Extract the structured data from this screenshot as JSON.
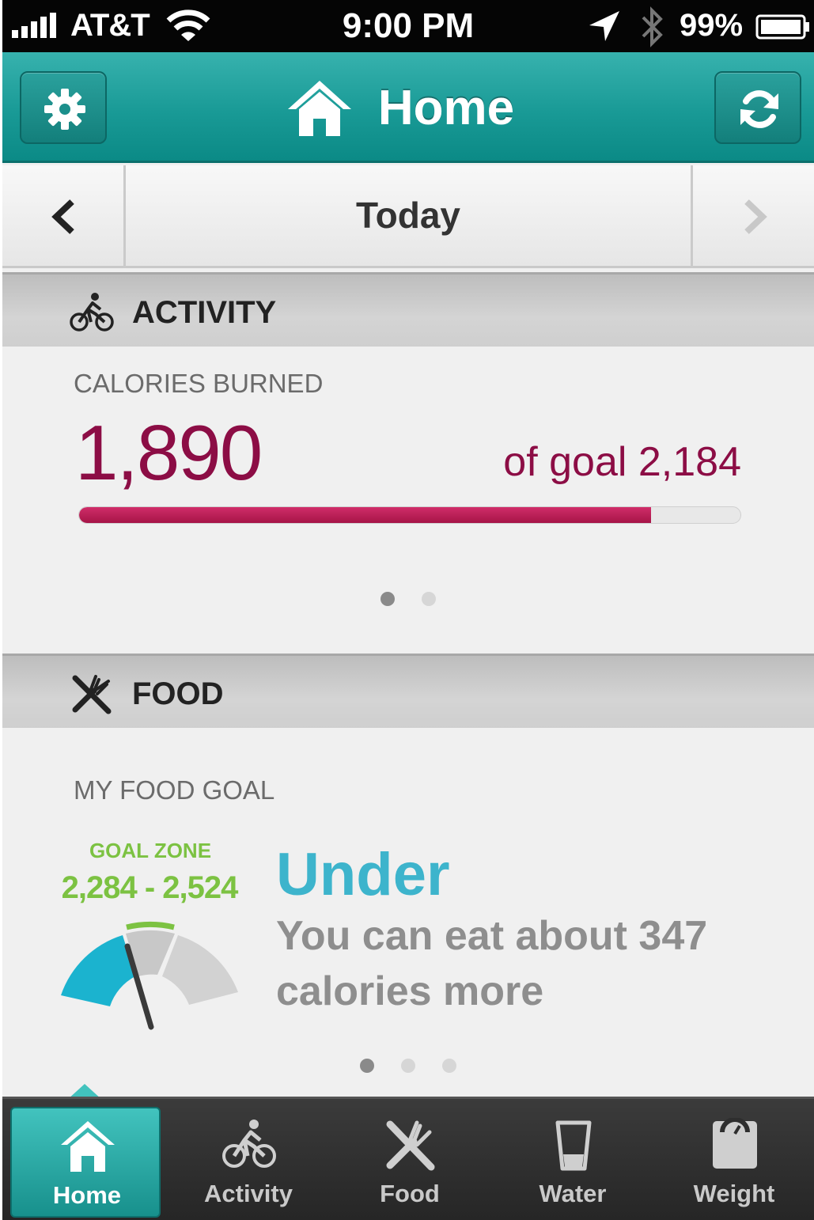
{
  "status_bar": {
    "carrier": "AT&T",
    "time": "9:00 PM",
    "battery_percent": "99%",
    "icons": [
      "signal-icon",
      "wifi-icon",
      "location-arrow-icon",
      "bluetooth-icon",
      "battery-icon"
    ]
  },
  "nav": {
    "title": "Home",
    "icons": {
      "left": "gear-icon",
      "center": "home-icon",
      "right": "sync-icon"
    }
  },
  "date_bar": {
    "label": "Today",
    "icons": {
      "prev": "chevron-left-icon",
      "next": "chevron-right-icon"
    }
  },
  "activity": {
    "section_title": "ACTIVITY",
    "icon": "bicycle-icon",
    "metric_label": "CALORIES BURNED",
    "value": "1,890",
    "goal_text": "of goal 2,184",
    "progress": 0.865,
    "colors": {
      "value": "#8c0d45",
      "bar": "#c2245e"
    },
    "page_dots": {
      "count": 2,
      "active": 0
    }
  },
  "food": {
    "section_title": "FOOD",
    "icon": "fork-knife-icon",
    "metric_label": "MY FOOD GOAL",
    "zone_label": "GOAL ZONE",
    "zone_range": "2,284 - 2,524",
    "status_word": "Under",
    "status_text": "You can eat about 347 calories more",
    "colors": {
      "zone": "#7cc242",
      "status": "#3db4cc",
      "gauge_fill": "#1bb3cf"
    },
    "page_dots": {
      "count": 3,
      "active": 0
    }
  },
  "tabs": [
    {
      "label": "Home",
      "icon": "home-icon",
      "selected": true
    },
    {
      "label": "Activity",
      "icon": "bicycle-icon",
      "selected": false
    },
    {
      "label": "Food",
      "icon": "fork-knife-icon",
      "selected": false
    },
    {
      "label": "Water",
      "icon": "glass-icon",
      "selected": false
    },
    {
      "label": "Weight",
      "icon": "scale-icon",
      "selected": false
    }
  ]
}
